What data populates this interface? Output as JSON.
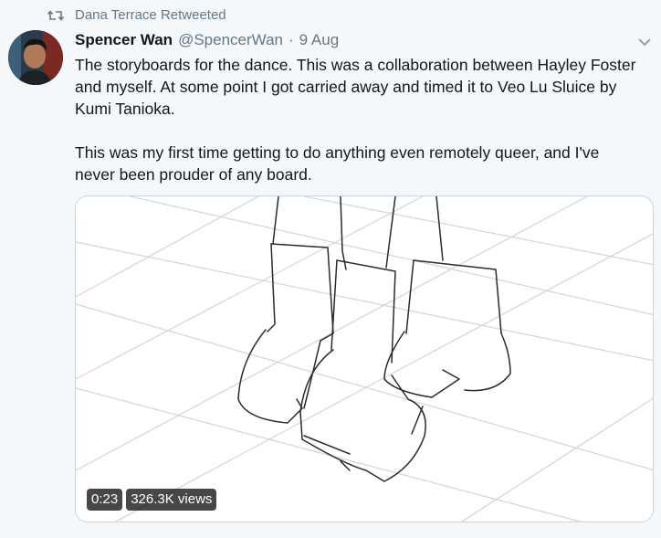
{
  "retweet": {
    "label": "Dana Terrace Retweeted",
    "icon": "retweet-icon"
  },
  "tweet": {
    "author_name": "Spencer Wan",
    "author_handle": "@SpencerWan",
    "separator": "·",
    "date": "9 Aug",
    "text": "The storyboards for the dance. This was a collaboration between Hayley Foster and myself. At some point I got carried away and timed it to Veo Lu Sluice by Kumi Tanioka.\n\nThis was my first time getting to do anything even remotely queer, and I've never been prouder of any board."
  },
  "video": {
    "duration": "0:23",
    "views": "326.3K views"
  },
  "colors": {
    "background": "#f5f8fa",
    "secondary_text": "#657786",
    "primary_text": "#14171a",
    "media_border": "#ccd6dd"
  }
}
